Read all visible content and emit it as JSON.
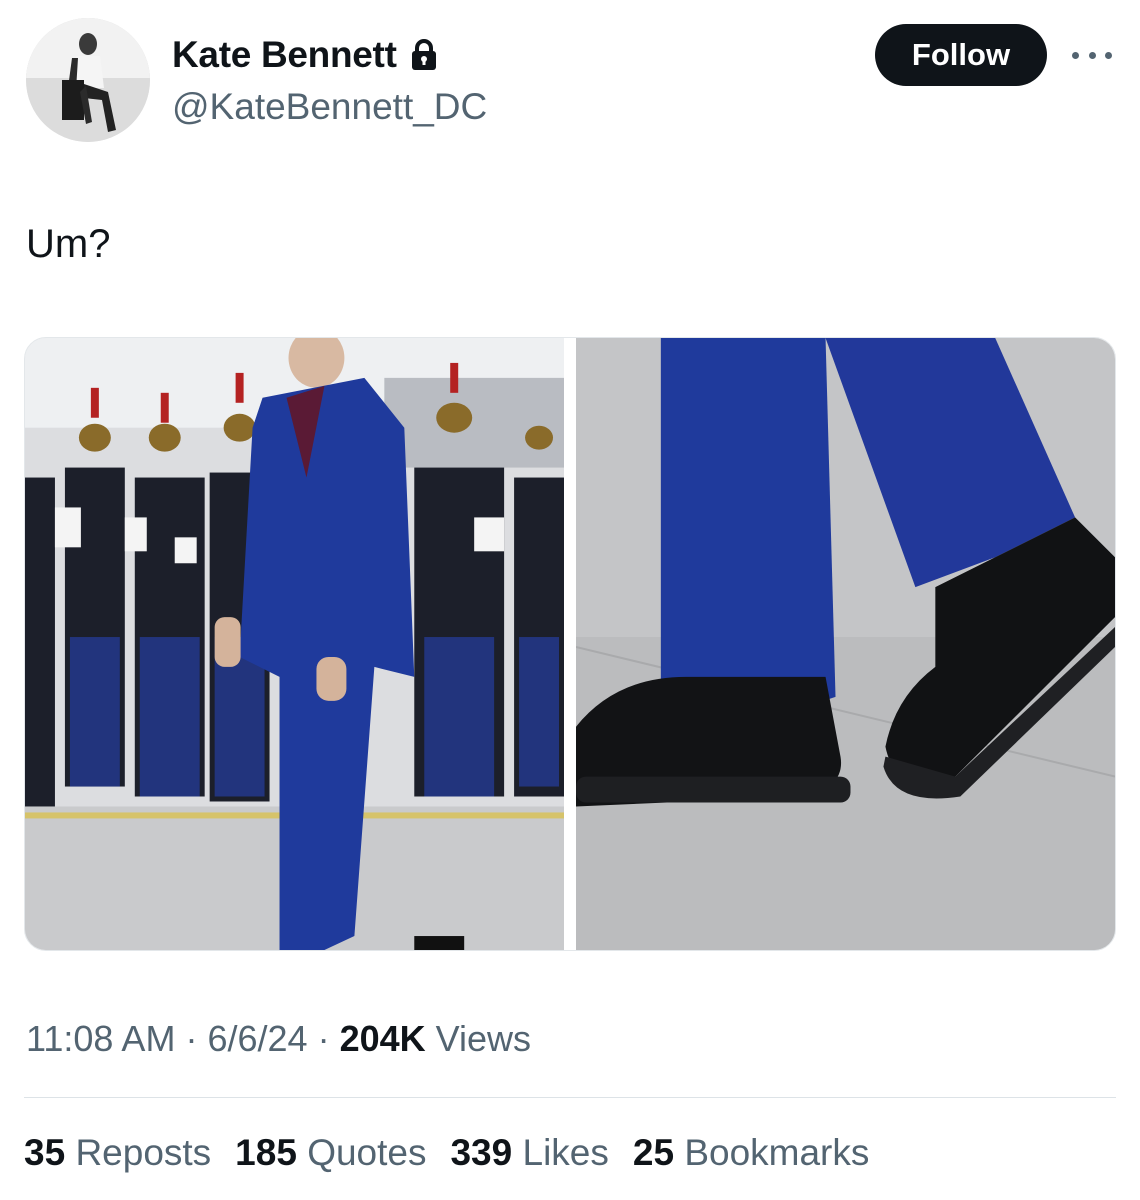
{
  "author": {
    "name": "Kate Bennett",
    "handle": "@KateBennett_DC",
    "avatar_icon": "profile-avatar",
    "badge_icon": "lock-icon"
  },
  "follow_button": {
    "label": "Follow"
  },
  "more_icon": "more-dots-icon",
  "tweet": {
    "text": "Um?",
    "images": [
      {
        "description_icon": "photo-man-blue-suit-honor-guard"
      },
      {
        "description_icon": "photo-black-shoes-closeup"
      }
    ]
  },
  "meta": {
    "time": "11:08 AM",
    "separator": "·",
    "date": "6/6/24",
    "views_count": "204K",
    "views_label": "Views"
  },
  "stats": {
    "reposts_count": "35",
    "reposts_label": "Reposts",
    "quotes_count": "185",
    "quotes_label": "Quotes",
    "likes_count": "339",
    "likes_label": "Likes",
    "bookmarks_count": "25",
    "bookmarks_label": "Bookmarks"
  },
  "colors": {
    "text": "#0f1419",
    "secondary": "#536471",
    "follow_bg": "#0f1419",
    "suit_blue": "#1f3a9c"
  }
}
